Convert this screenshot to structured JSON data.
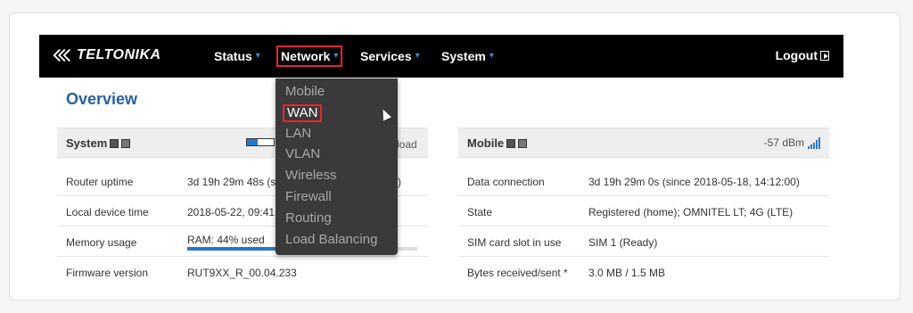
{
  "brand": {
    "name": "TELTONIKA"
  },
  "nav": {
    "items": [
      {
        "label": "Status"
      },
      {
        "label": "Network"
      },
      {
        "label": "Services"
      },
      {
        "label": "System"
      }
    ],
    "logout": "Logout"
  },
  "page": {
    "title": "Overview"
  },
  "system_panel": {
    "title": "System",
    "load_label": "load",
    "rows": [
      {
        "key": "Router uptime",
        "value": "3d 19h 29m 48s (s",
        "value_tail": ")"
      },
      {
        "key": "Local device time",
        "value": "2018-05-22, 09:41"
      },
      {
        "key": "Memory usage",
        "value": "RAM: 44% used",
        "progress": 0.44
      },
      {
        "key": "Firmware version",
        "value": "RUT9XX_R_00.04.233"
      }
    ]
  },
  "mobile_panel": {
    "title": "Mobile",
    "signal": "-57 dBm",
    "rows": [
      {
        "key": "Data connection",
        "value": "3d 19h 29m 0s (since 2018-05-18, 14:12:00)"
      },
      {
        "key": "State",
        "value": "Registered (home); OMNITEL LT; 4G (LTE)"
      },
      {
        "key": "SIM card slot in use",
        "value": "SIM 1 (Ready)"
      },
      {
        "key": "Bytes received/sent *",
        "value": "3.0 MB / 1.5 MB"
      }
    ]
  },
  "dropdown": {
    "items": [
      "Mobile",
      "WAN",
      "LAN",
      "VLAN",
      "Wireless",
      "Firewall",
      "Routing",
      "Load Balancing"
    ],
    "hovered": "WAN"
  },
  "colors": {
    "accent": "#25609f",
    "highlight": "#e8262b",
    "navbar": "#000000"
  }
}
